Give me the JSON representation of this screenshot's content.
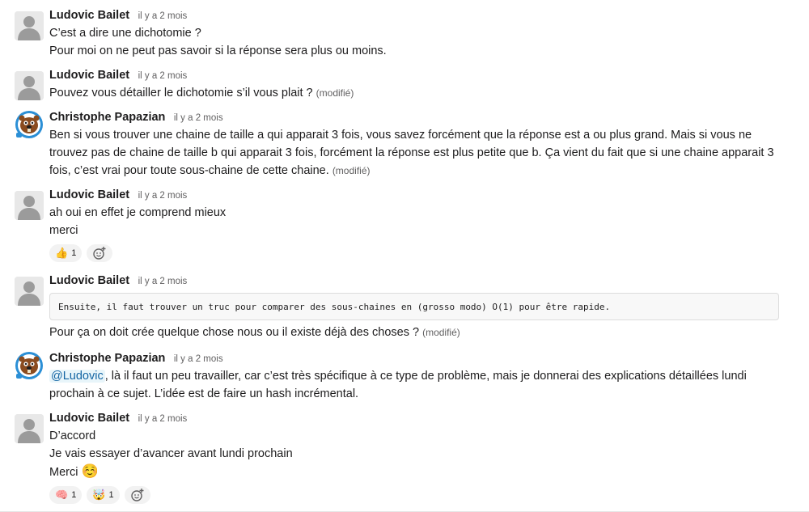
{
  "messages": [
    {
      "author": "Ludovic Bailet",
      "time": "il y a 2 mois",
      "lines": [
        "C’est a dire une dichotomie ?",
        "Pour moi on ne peut pas savoir si la réponse sera plus ou moins."
      ]
    },
    {
      "author": "Ludovic Bailet",
      "time": "il y a 2 mois",
      "text": "Pouvez vous détailler le dichotomie s’il vous plait ?",
      "edited": "(modifié)"
    },
    {
      "author": "Christophe Papazian",
      "time": "il y a 2 mois",
      "line1": "Ben si vous trouver une chaine de taille a qui apparait 3 fois, vous savez forcément que la réponse est a ou plus grand. Mais si vous ne",
      "line2": "trouvez pas de chaine de taille b qui apparait 3 fois, forcément la réponse est plus petite que b. Ça vient du fait que si une chaine apparait 3",
      "line3": "fois, c’est vrai pour toute sous-chaine de cette chaine.",
      "edited": "(modifié)"
    },
    {
      "author": "Ludovic Bailet",
      "time": "il y a 2 mois",
      "lines": [
        "ah oui en effet je comprend mieux",
        "merci"
      ],
      "reactions": [
        {
          "emoji": "👍",
          "count": "1"
        }
      ]
    },
    {
      "author": "Ludovic Bailet",
      "time": "il y a 2 mois",
      "code": "Ensuite, il faut trouver un truc pour comparer des sous-chaines en (grosso modo) O(1) pour être rapide.",
      "text": "Pour ça on doit crée quelque chose nous ou il existe déjà des choses ?",
      "edited": "(modifié)"
    },
    {
      "author": "Christophe Papazian",
      "time": "il y a 2 mois",
      "mention": "@Ludovic",
      "line1": ", là il faut un peu travailler, car c’est très spécifique à ce type de problème, mais je donnerai des explications détaillées lundi",
      "line2": "prochain à ce sujet. L’idée est de faire un hash incrémental."
    },
    {
      "author": "Ludovic Bailet",
      "time": "il y a 2 mois",
      "lines": [
        "D’accord",
        "Je vais essayer d’avancer avant lundi prochain",
        "Merci"
      ],
      "emoji": "☺️",
      "reactions": [
        {
          "emoji": "🧠",
          "count": "1"
        },
        {
          "emoji": "🤯",
          "count": "1"
        }
      ]
    }
  ],
  "icons": {
    "avatar_default": "user-silhouette-icon",
    "avatar_beaver": "beaver-icon",
    "add_reaction": "add-reaction-icon"
  }
}
